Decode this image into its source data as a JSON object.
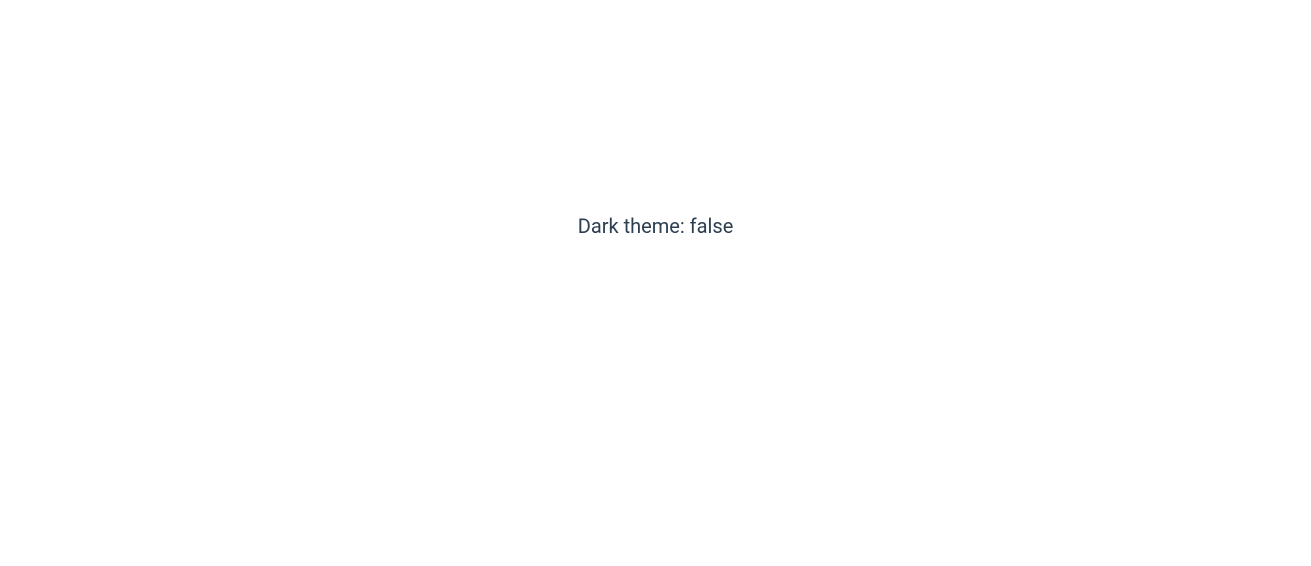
{
  "theme": {
    "status_text": "Dark theme: false"
  }
}
